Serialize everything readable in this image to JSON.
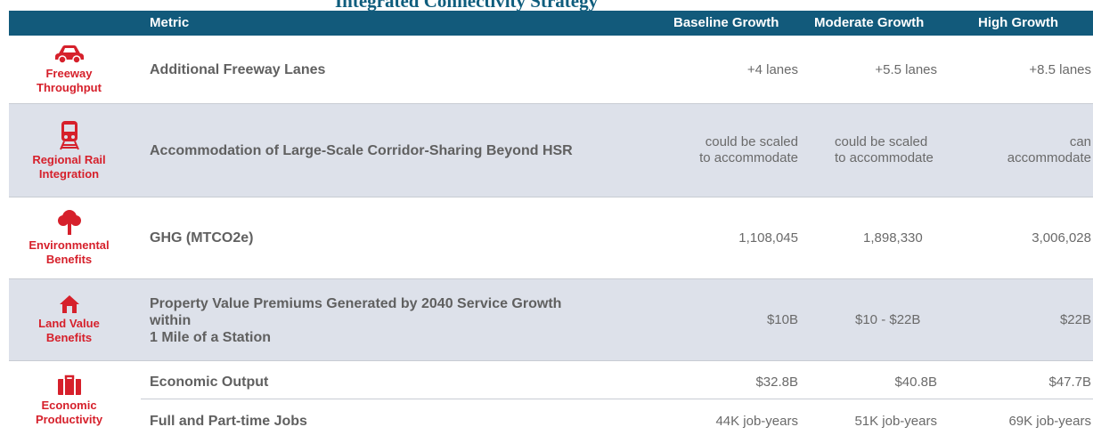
{
  "title": "Integrated Connectivity Strategy",
  "header": {
    "metric": "Metric",
    "baseline": "Baseline Growth",
    "moderate": "Moderate Growth",
    "high": "High Growth"
  },
  "rows": [
    {
      "category": [
        "Freeway",
        "Throughput"
      ],
      "icon": "car-icon",
      "metric": "Additional Freeway Lanes",
      "baseline": "+4 lanes",
      "moderate": "+5.5 lanes",
      "high": "+8.5 lanes"
    },
    {
      "category": [
        "Regional Rail",
        "Integration"
      ],
      "icon": "train-icon",
      "metric": "Accommodation of Large-Scale Corridor-Sharing Beyond HSR",
      "baseline": [
        "could be scaled",
        "to accommodate"
      ],
      "moderate": [
        "could be scaled",
        "to accommodate"
      ],
      "high": [
        "can",
        "accommodate"
      ]
    },
    {
      "category": [
        "Environmental",
        "Benefits"
      ],
      "icon": "tree-icon",
      "metric": "GHG (MTCO2e)",
      "baseline": "1,108,045",
      "moderate": "1,898,330",
      "high": "3,006,028"
    },
    {
      "category": [
        "Land Value",
        "Benefits"
      ],
      "icon": "house-icon",
      "metric": [
        "Property Value Premiums Generated by 2040 Service Growth",
        "within",
        "1 Mile of a Station"
      ],
      "baseline": "$10B",
      "moderate": "$10 - $22B",
      "high": "$22B"
    },
    {
      "category": [
        "Economic",
        "Productivity"
      ],
      "icon": "briefcase-icon",
      "metric": "Economic Output",
      "baseline": "$32.8B",
      "moderate": "$40.8B",
      "high": "$47.7B"
    },
    {
      "metric": "Full and Part-time Jobs",
      "baseline": "44K job-years",
      "moderate": "51K job-years",
      "high": "69K job-years"
    }
  ],
  "colors": {
    "header_bg": "#125a7b",
    "accent_red": "#d6202b",
    "shaded_row": "#dde1ea"
  }
}
